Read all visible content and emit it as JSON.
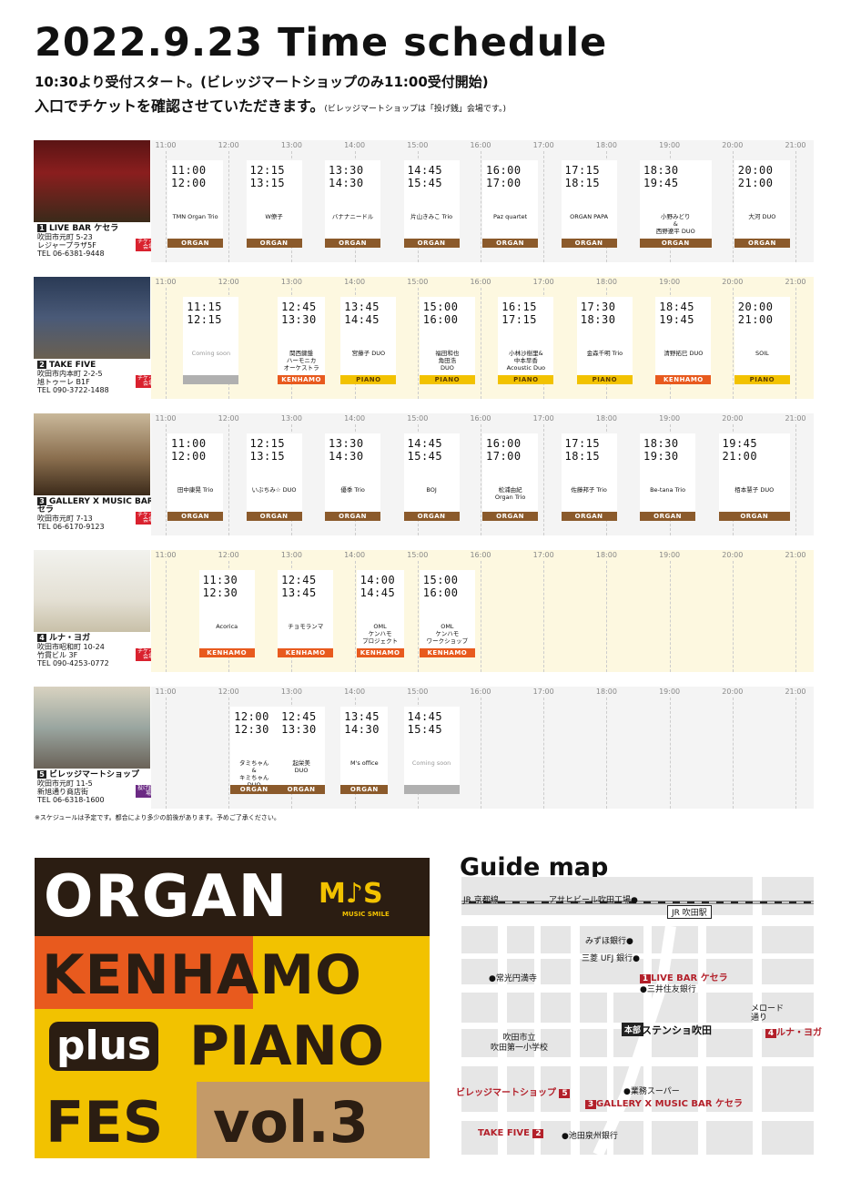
{
  "header": {
    "title": "2022.9.23 Time schedule",
    "line1": "10:30より受付スタート。(ビレッジマートショップのみ11:00受付開始)",
    "line2": "入口でチケットを確認させていただきます。",
    "line2_small": "(ビレッジマートショップは「投げ銭」会場です。)"
  },
  "timeline": {
    "hours": [
      "11:00",
      "12:00",
      "13:00",
      "14:00",
      "15:00",
      "16:00",
      "17:00",
      "18:00",
      "19:00",
      "20:00",
      "21:00"
    ]
  },
  "venues": [
    {
      "num": "1",
      "name": "LIVE BAR ケセラ",
      "addr1": "吹田市元町 5-23",
      "addr2": "レジャープラザ5F",
      "tel": "TEL 06-6381-9448",
      "tag": "チケット会場",
      "tag_color": "#d9212e",
      "photo": "live-bar",
      "slots": [
        {
          "s": 11,
          "e": 12,
          "t1": "11:00",
          "t2": "12:00",
          "perf": "TMN Organ Trio",
          "badge": "ORGAN"
        },
        {
          "s": 12.25,
          "e": 13.25,
          "t1": "12:15",
          "t2": "13:15",
          "perf": "W僚子",
          "badge": "ORGAN"
        },
        {
          "s": 13.5,
          "e": 14.5,
          "t1": "13:30",
          "t2": "14:30",
          "perf": "バナナニードル",
          "badge": "ORGAN"
        },
        {
          "s": 14.75,
          "e": 15.75,
          "t1": "14:45",
          "t2": "15:45",
          "perf": "片山きみこ Trio",
          "badge": "ORGAN"
        },
        {
          "s": 16,
          "e": 17,
          "t1": "16:00",
          "t2": "17:00",
          "perf": "Paz quartet",
          "badge": "ORGAN"
        },
        {
          "s": 17.25,
          "e": 18.25,
          "t1": "17:15",
          "t2": "18:15",
          "perf": "ORGAN PAPA",
          "badge": "ORGAN"
        },
        {
          "s": 18.5,
          "e": 19.75,
          "t1": "18:30",
          "t2": "19:45",
          "perf": "小野みどり\n&\n西野遼平 DUO",
          "badge": "ORGAN"
        },
        {
          "s": 20,
          "e": 21,
          "t1": "20:00",
          "t2": "21:00",
          "perf": "大河 DUO",
          "badge": "ORGAN"
        }
      ]
    },
    {
      "num": "2",
      "name": "TAKE FIVE",
      "addr1": "吹田市内本町 2-2-5",
      "addr2": "旭トゥーレ B1F",
      "tel": "TEL 090-3722-1488",
      "tag": "チケット会場",
      "tag_color": "#d9212e",
      "photo": "take-five",
      "slots": [
        {
          "s": 11.25,
          "e": 12.25,
          "t1": "11:15",
          "t2": "12:15",
          "perf": "Coming soon",
          "badge": "",
          "badge_kind": "gray"
        },
        {
          "s": 12.75,
          "e": 13.5,
          "t1": "12:45",
          "t2": "13:30",
          "perf": "関西鍵盤\nハーモニカ\nオーケストラ",
          "badge": "KENHAMO"
        },
        {
          "s": 13.75,
          "e": 14.75,
          "t1": "13:45",
          "t2": "14:45",
          "perf": "宮藤子 DUO",
          "badge": "PIANO"
        },
        {
          "s": 15,
          "e": 16,
          "t1": "15:00",
          "t2": "16:00",
          "perf": "福田和也\n角田浩\nDUO",
          "badge": "PIANO"
        },
        {
          "s": 16.25,
          "e": 17.25,
          "t1": "16:15",
          "t2": "17:15",
          "perf": "小林沙樹里&\n中本早香\nAcoustic Duo",
          "badge": "PIANO"
        },
        {
          "s": 17.5,
          "e": 18.5,
          "t1": "17:30",
          "t2": "18:30",
          "perf": "金森千明 Trio",
          "badge": "PIANO"
        },
        {
          "s": 18.75,
          "e": 19.75,
          "t1": "18:45",
          "t2": "19:45",
          "perf": "清野拓巳 DUO",
          "badge": "KENHAMO"
        },
        {
          "s": 20,
          "e": 21,
          "t1": "20:00",
          "t2": "21:00",
          "perf": "SOIL",
          "badge": "PIANO"
        }
      ]
    },
    {
      "num": "3",
      "name": "GALLERY X MUSIC BAR ケセラ",
      "addr1": "吹田市元町 7-13",
      "addr2": "",
      "tel": "TEL 06-6170-9123",
      "tag": "チケット会場",
      "tag_color": "#d9212e",
      "photo": "gallery",
      "slots": [
        {
          "s": 11,
          "e": 12,
          "t1": "11:00",
          "t2": "12:00",
          "perf": "田中康晃 Trio",
          "badge": "ORGAN"
        },
        {
          "s": 12.25,
          "e": 13.25,
          "t1": "12:15",
          "t2": "13:15",
          "perf": "いぶちみ☆ DUO",
          "badge": "ORGAN"
        },
        {
          "s": 13.5,
          "e": 14.5,
          "t1": "13:30",
          "t2": "14:30",
          "perf": "優季 Trio",
          "badge": "ORGAN"
        },
        {
          "s": 14.75,
          "e": 15.75,
          "t1": "14:45",
          "t2": "15:45",
          "perf": "BOJ",
          "badge": "ORGAN"
        },
        {
          "s": 16,
          "e": 17,
          "t1": "16:00",
          "t2": "17:00",
          "perf": "松浦由紀\nOrgan Trio",
          "badge": "ORGAN"
        },
        {
          "s": 17.25,
          "e": 18.25,
          "t1": "17:15",
          "t2": "18:15",
          "perf": "佐藤邦子 Trio",
          "badge": "ORGAN"
        },
        {
          "s": 18.5,
          "e": 19.5,
          "t1": "18:30",
          "t2": "19:30",
          "perf": "Be-tana Trio",
          "badge": "ORGAN"
        },
        {
          "s": 19.75,
          "e": 21,
          "t1": "19:45",
          "t2": "21:00",
          "perf": "栢本慧子 DUO",
          "badge": "ORGAN"
        }
      ]
    },
    {
      "num": "4",
      "name": "ルナ・ヨガ",
      "addr1": "吹田市昭和町 10-24",
      "addr2": "竹貫ビル 3F",
      "tel": "TEL 090-4253-0772",
      "tag": "チケット会場",
      "tag_color": "#d9212e",
      "photo": "luna",
      "slots": [
        {
          "s": 11.5,
          "e": 12.5,
          "t1": "11:30",
          "t2": "12:30",
          "perf": "Acorica",
          "badge": "KENHAMO"
        },
        {
          "s": 12.75,
          "e": 13.75,
          "t1": "12:45",
          "t2": "13:45",
          "perf": "チョモランマ",
          "badge": "KENHAMO"
        },
        {
          "s": 14,
          "e": 14.75,
          "t1": "14:00",
          "t2": "14:45",
          "perf": "OML\nケンハモ\nプロジェクト",
          "badge": "KENHAMO"
        },
        {
          "s": 15,
          "e": 16,
          "t1": "15:00",
          "t2": "16:00",
          "perf": "OML\nケンハモ\nワークショップ",
          "badge": "KENHAMO"
        }
      ]
    },
    {
      "num": "5",
      "name": "ビレッジマートショップ",
      "addr1": "吹田市元町 11-5",
      "addr2": "新旭通り商店街",
      "tel": "TEL 06-6318-1600",
      "tag": "投げ銭会場",
      "tag_color": "#6b2a84",
      "photo": "village",
      "slots": [
        {
          "s": 12,
          "e": 12.5,
          "t1": "12:00",
          "t2": "12:30",
          "perf": "タミちゃん\n&\nキミちゃん\nDUO",
          "badge": "ORGAN"
        },
        {
          "s": 12.75,
          "e": 13.5,
          "t1": "12:45",
          "t2": "13:30",
          "perf": "起栄美\nDUO",
          "badge": "ORGAN"
        },
        {
          "s": 13.75,
          "e": 14.5,
          "t1": "13:45",
          "t2": "14:30",
          "perf": "M's office",
          "badge": "ORGAN"
        },
        {
          "s": 14.75,
          "e": 15.75,
          "t1": "14:45",
          "t2": "15:45",
          "perf": "Coming soon",
          "badge": "",
          "badge_kind": "gray"
        }
      ]
    }
  ],
  "badge_colors": {
    "ORGAN": "#8b5a2b",
    "KENHAMO": "#e85a1e",
    "PIANO": "#f2c200",
    "gray": "#b0b0b0"
  },
  "footnote": "※スケジュールは予定です。都合により多少の前後があります。予めご了承ください。",
  "fes": {
    "w1": "ORGAN",
    "ms": "M♪S",
    "ms_sub": "MUSIC SMILE",
    "w2": "KENHAMO",
    "w3a": "plus",
    "w3b": "PIANO",
    "w4": "FES",
    "w5": "vol.3"
  },
  "map": {
    "title": "Guide map",
    "labels": {
      "jr_line": "JR 京都線",
      "asahi": "アサヒビール吹田工場●",
      "jr_station": "JR 吹田駅",
      "mizuho": "みずほ銀行●",
      "mufg": "三菱 UFJ 銀行●",
      "jokoji": "●常光円満寺",
      "smbc": "●三井住友銀行",
      "school": "吹田市立\n吹田第一小学校",
      "honbu": "本部",
      "station": "ステンショ吹田",
      "melody": "メロード\n通り",
      "super": "●業務スーパー",
      "ikeda": "●池田泉州銀行"
    },
    "venues": {
      "v1": "LIVE BAR ケセラ",
      "v2": "TAKE FIVE",
      "v3": "GALLERY X MUSIC BAR ケセラ",
      "v4": "ルナ・ヨガ",
      "v5": "ビレッジマートショップ"
    }
  }
}
